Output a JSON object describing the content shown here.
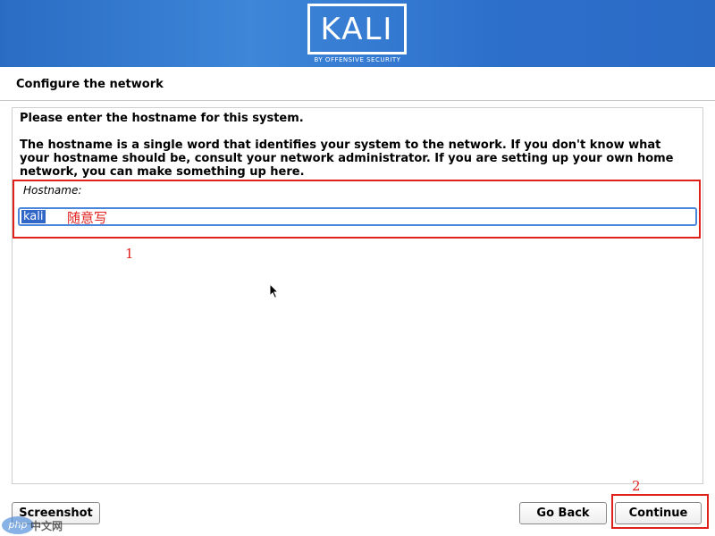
{
  "header": {
    "logo_text": "KALI",
    "logo_subtitle": "BY OFFENSIVE SECURITY"
  },
  "page": {
    "title": "Configure the network"
  },
  "content": {
    "prompt": "Please enter the hostname for this system.",
    "description": "The hostname is a single word that identifies your system to the network. If you don't know what your hostname should be, consult your network administrator. If you are setting up your own home network, you can make something up here.",
    "field_label": "Hostname:",
    "hostname_value": "kali"
  },
  "annotations": {
    "input_note": "随意写",
    "step1": "1",
    "step2": "2",
    "color": "#e0201b"
  },
  "buttons": {
    "screenshot": "Screenshot",
    "go_back": "Go Back",
    "continue": "Continue"
  },
  "watermark": {
    "brand": "php",
    "text": "中文网"
  }
}
